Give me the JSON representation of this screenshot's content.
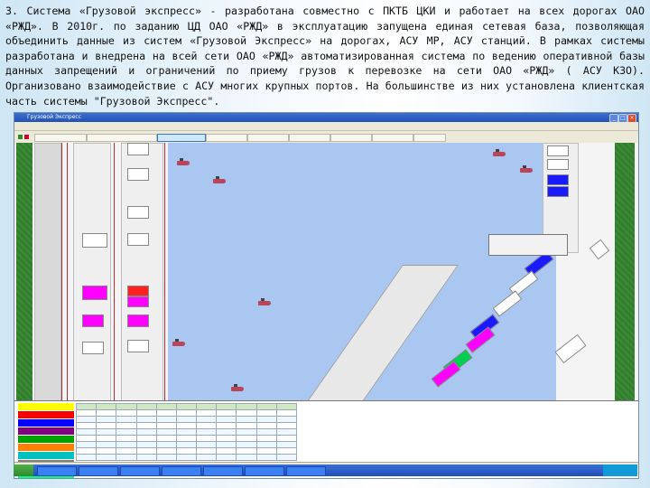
{
  "slide": {
    "paragraph": "3. Система «Грузовой экспресс» - разработана совместно с ПКТБ ЦКИ и работает на всех дорогах ОАО «РЖД». В 2010г. по заданию ЦД ОАО «РЖД» в эксплуатацию запущена единая сетевая база, позволяющая объединить данные из систем «Грузовой Экспресс» на дорогах, АСУ МР, АСУ станций. В рамках системы разработана и внедрена на всей сети ОАО «РЖД» автоматизированная система по ведению оперативной базы данных запрещений и ограничений по приему грузов к перевозке на сети ОАО «РЖД» ( АСУ КЗО). Организовано взаимодействие с АСУ многих крупных портов. На большинстве из них установлена клиентская часть системы \"Грузовой Экспресс\"."
  },
  "app": {
    "title_text": "Грузовой Экспресс",
    "toolbar_buttons": [
      "",
      "",
      "",
      "",
      "",
      "",
      "",
      "",
      ""
    ],
    "active_tab_index": 2
  },
  "map": {
    "sea_color": "#a9c7f0",
    "grass_color": "#2f7f2b",
    "berth_colors": [
      "#1a1aff",
      "#ff00ff",
      "#ff2020",
      "#00d050",
      "#ffffff"
    ]
  },
  "table": {
    "headers": [
      "",
      "",
      "",
      "",
      "",
      "",
      "",
      "",
      "",
      "",
      ""
    ],
    "rows": 8
  },
  "legend_colors": [
    "#ffff00",
    "#ff0000",
    "#0000ff",
    "#800080",
    "#00a000",
    "#ff8000",
    "#00c0c0",
    "#808080",
    "#ff00ff",
    "#00ff80",
    "#c0c0ff",
    "#ff8080"
  ],
  "taskbar": {
    "start_label": "",
    "tasks": [
      "",
      "",
      "",
      "",
      "",
      "",
      ""
    ],
    "clock": ""
  }
}
